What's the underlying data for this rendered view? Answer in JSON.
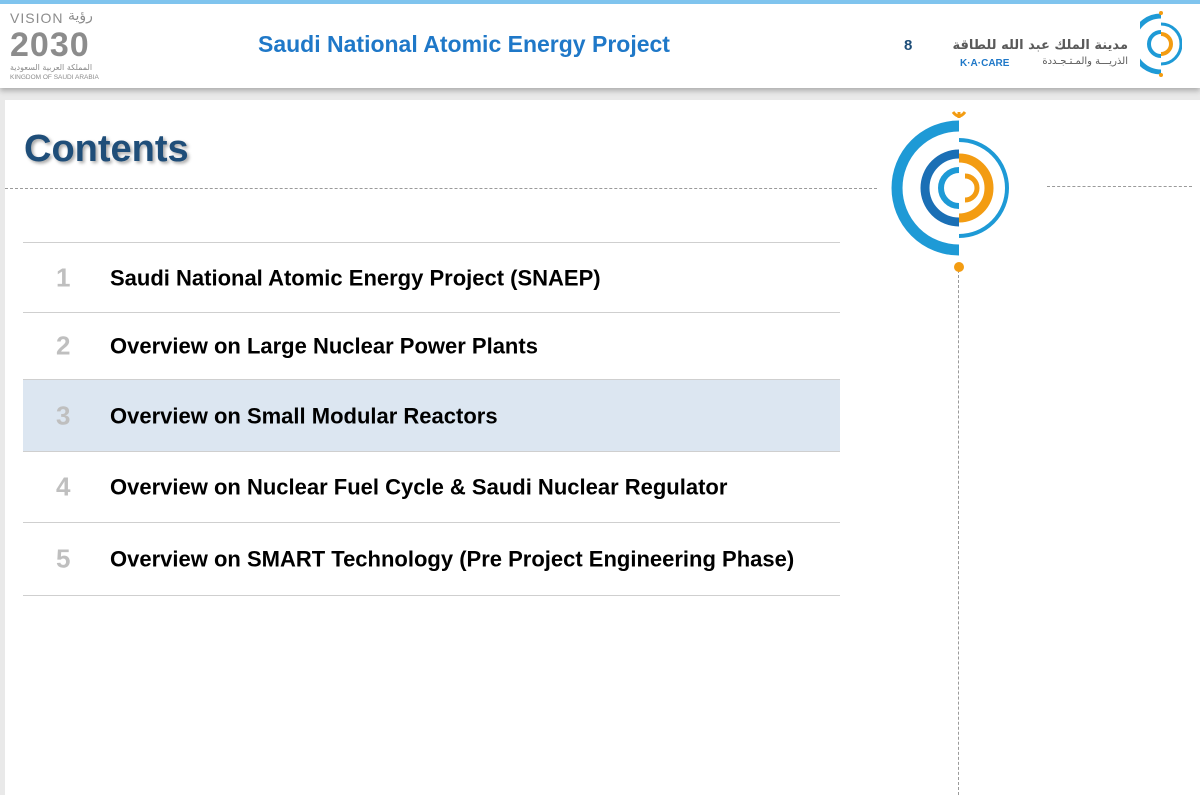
{
  "header": {
    "title": "Saudi National Atomic Energy Project",
    "page_number": "8",
    "vision_logo": {
      "word": "VISION",
      "arabic_word": "رؤية",
      "year": "2030",
      "arabic_country": "المملكة العربية السعودية",
      "country": "KINGDOM OF SAUDI ARABIA"
    },
    "kacare_logo": {
      "arabic_line1": "مدينة الملك عبد الله للطاقة",
      "arabic_line2": "الذريـــة والمـتـجـددة",
      "english": "K·A·CARE"
    }
  },
  "slide": {
    "title": "Contents"
  },
  "toc": {
    "items": [
      {
        "number": "1",
        "text": "Saudi National Atomic Energy Project (SNAEP)"
      },
      {
        "number": "2",
        "text": "Overview on Large Nuclear Power Plants"
      },
      {
        "number": "3",
        "text": "Overview on Small Modular Reactors"
      },
      {
        "number": "4",
        "text": "Overview on Nuclear Fuel Cycle & Saudi Nuclear Regulator"
      },
      {
        "number": "5",
        "text": "Overview on SMART Technology (Pre Project Engineering Phase)"
      }
    ],
    "active_item": "3"
  },
  "colors": {
    "header_title": "#1f78c8",
    "slide_title": "#1f4e79",
    "active_row_bg": "#dce6f1",
    "accent_blue": "#1e9ad6",
    "accent_orange": "#f39c12"
  }
}
